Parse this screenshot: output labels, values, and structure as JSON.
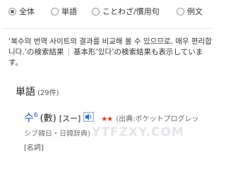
{
  "tabs": [
    {
      "label": "全体",
      "selected": true
    },
    {
      "label": "単語",
      "selected": false
    },
    {
      "label": "ことわざ/慣用句",
      "selected": false
    },
    {
      "label": "例文",
      "selected": false
    }
  ],
  "result_info": {
    "query": "‘복수의 번역 사이트의 결과를 비교해 볼 수 있으므로, 매우 편리합니다.’",
    "suffix": "の検索結果",
    "separator": "|",
    "note_prefix": "基本形‘있다’",
    "note_suffix": "の検索結果も表示しています。"
  },
  "section": {
    "title": "単語",
    "count": "(29件)"
  },
  "entry": {
    "headword": "수",
    "homograph_number": "6",
    "kanji": "(數)",
    "kana": "[スー]",
    "speaker_icon": "speaker-icon",
    "stars": "★★",
    "source": "(出典:ポケットプログレッ",
    "dictionary": "シブ韓日・日韓辞典)",
    "part_of_speech": "[名詞]"
  },
  "watermark": "YTFZXY.COM",
  "colors": {
    "link": "#1a56b0",
    "stars": "#e0321d",
    "watermark": "#cdcdd7"
  }
}
